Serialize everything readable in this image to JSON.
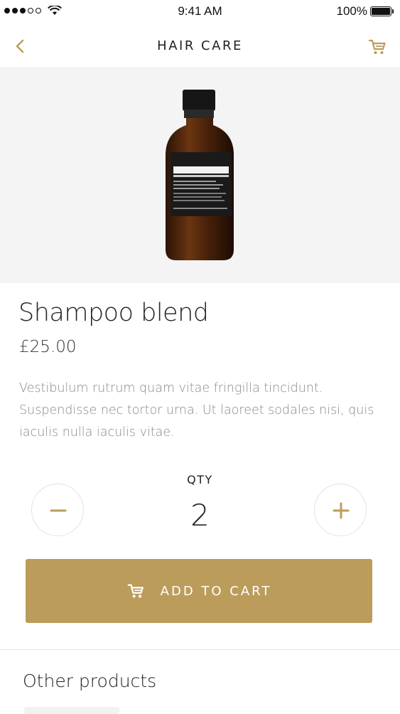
{
  "status_bar": {
    "time": "9:41 AM",
    "battery": "100%",
    "signal_icon": "signal-dots-icon",
    "wifi_icon": "wifi-icon",
    "battery_icon": "battery-icon"
  },
  "nav": {
    "title": "HAIR CARE",
    "back_icon": "chevron-left-icon",
    "cart_icon": "cart-icon"
  },
  "product": {
    "name": "Shampoo blend",
    "price": "£25.00",
    "description": "Vestibulum rutrum quam vitae fringilla tincidunt. Suspendisse nec tortor urna. Ut laoreet sodales nisi, quis iaculis nulla iaculis vitae.",
    "image_icon": "product-bottle-image"
  },
  "quantity": {
    "label": "QTY",
    "value": "2",
    "decrement_icon": "minus-icon",
    "increment_icon": "plus-icon"
  },
  "add_to_cart": {
    "label": "ADD TO CART",
    "icon": "cart-icon"
  },
  "other_products": {
    "title": "Other products"
  },
  "colors": {
    "accent": "#bc9c5b",
    "background": "#ffffff",
    "image_background": "#f4f4f4",
    "text_muted": "#888888"
  }
}
